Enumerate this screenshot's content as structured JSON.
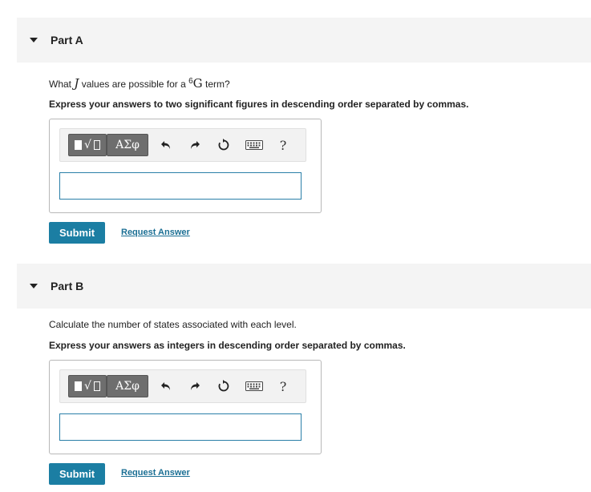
{
  "parts": [
    {
      "title": "Part A",
      "question_prefix": "What ",
      "question_var": "J",
      "question_mid": " values are possible for a ",
      "question_sup": "6",
      "question_term": "G",
      "question_suffix": " term?",
      "instruction": "Express your answers to two significant figures in descending order separated by commas.",
      "answer_value": "",
      "submit_label": "Submit",
      "request_label": "Request Answer"
    },
    {
      "title": "Part B",
      "question": "Calculate the number of states associated with each level.",
      "instruction": "Express your answers as integers in descending order separated by commas.",
      "answer_value": "",
      "submit_label": "Submit",
      "request_label": "Request Answer"
    }
  ],
  "toolbar": {
    "greek_label": "ΑΣφ",
    "help_label": "?",
    "icons": [
      "templates-icon",
      "greek-letters-icon",
      "undo-icon",
      "redo-icon",
      "reset-icon",
      "keyboard-icon",
      "help-icon"
    ]
  }
}
